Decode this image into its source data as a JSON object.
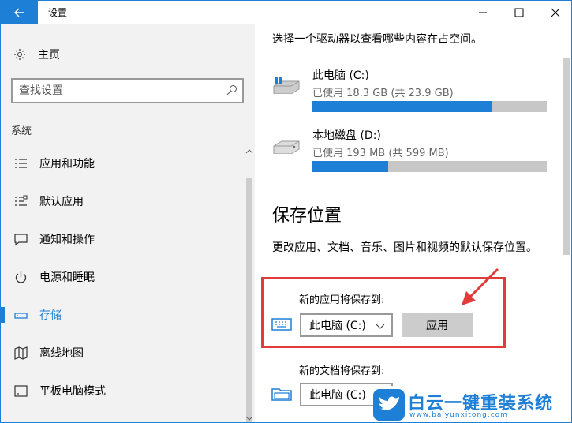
{
  "window": {
    "title": "设置"
  },
  "sidebar": {
    "home_label": "主页",
    "search_placeholder": "查找设置",
    "section_label": "系统",
    "items": [
      {
        "label": "应用和功能",
        "icon": "list-icon"
      },
      {
        "label": "默认应用",
        "icon": "default-apps-icon"
      },
      {
        "label": "通知和操作",
        "icon": "notification-icon"
      },
      {
        "label": "电源和睡眠",
        "icon": "power-icon"
      },
      {
        "label": "存储",
        "icon": "storage-icon",
        "active": true
      },
      {
        "label": "离线地图",
        "icon": "map-icon"
      },
      {
        "label": "平板电脑模式",
        "icon": "tablet-icon"
      }
    ]
  },
  "main": {
    "intro": "选择一个驱动器以查看哪些内容在占空间。",
    "drives": [
      {
        "name": "此电脑 (C:)",
        "used_text": "已使用 18.3 GB (共 23.9 GB)",
        "used_fraction": 0.766
      },
      {
        "name": "本地磁盘 (D:)",
        "used_text": "已使用 193 MB (共 599 MB)",
        "used_fraction": 0.322
      }
    ],
    "save_heading": "保存位置",
    "save_description": "更改应用、文档、音乐、图片和视频的默认保存位置。",
    "apps": {
      "label": "新的应用将保存到:",
      "selected": "此电脑 (C:)",
      "apply_label": "应用"
    },
    "docs": {
      "label": "新的文档将保存到:",
      "selected": "此电脑 (C:)"
    }
  },
  "watermark": {
    "brand": "白云一键重装系统",
    "url": "www.baiyunxitong.com"
  },
  "colors": {
    "accent": "#1e7fd6",
    "highlight": "#e23b3b",
    "bar_bg": "#c7c7c7"
  }
}
